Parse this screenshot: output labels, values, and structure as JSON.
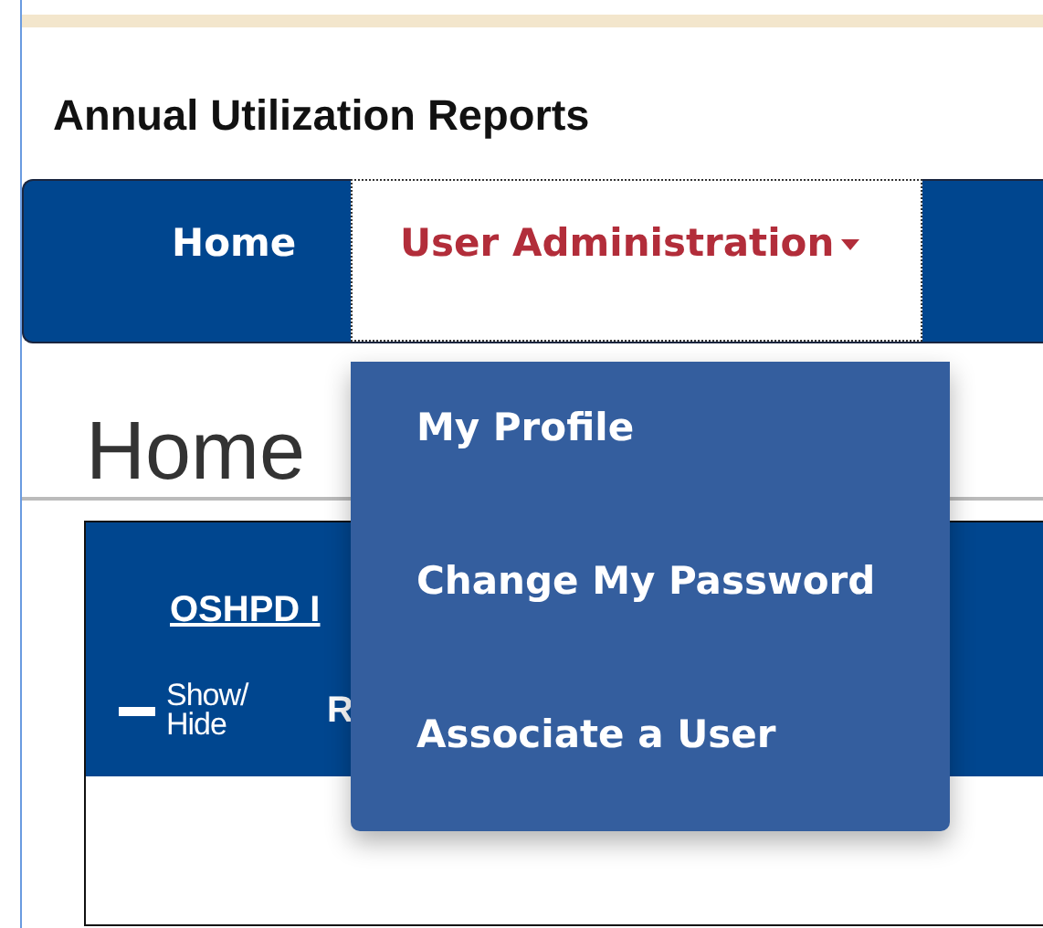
{
  "site_title": "Annual Utilization Reports",
  "nav": [
    {
      "label": "Home",
      "selected": false
    },
    {
      "label": "User Administration",
      "selected": true,
      "expanded": true,
      "menu": [
        "My Profile",
        "Change My Password",
        "Associate a User"
      ]
    }
  ],
  "heading": "Home",
  "panel": {
    "link": "OSHPD I",
    "toggle": "Show/ Hide",
    "column_2": "R"
  }
}
